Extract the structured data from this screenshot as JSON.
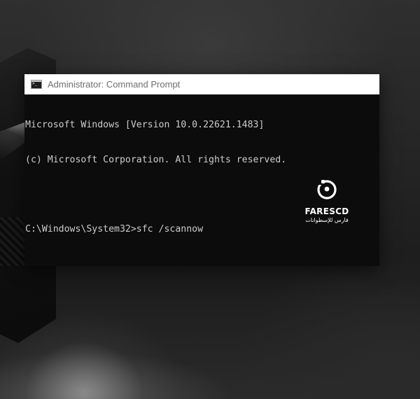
{
  "window": {
    "title": "Administrator: Command Prompt",
    "icon": "cmd-icon"
  },
  "console": {
    "lines": [
      "Microsoft Windows [Version 10.0.22621.1483]",
      "(c) Microsoft Corporation. All rights reserved.",
      "",
      "C:\\Windows\\System32>sfc /scannow"
    ]
  },
  "watermark": {
    "brand": "FARESCD",
    "subtitle": "فارس للإسطوانات"
  },
  "colors": {
    "console_bg": "#0c0c0c",
    "console_text": "#cccccc",
    "titlebar_bg": "#ffffff"
  }
}
